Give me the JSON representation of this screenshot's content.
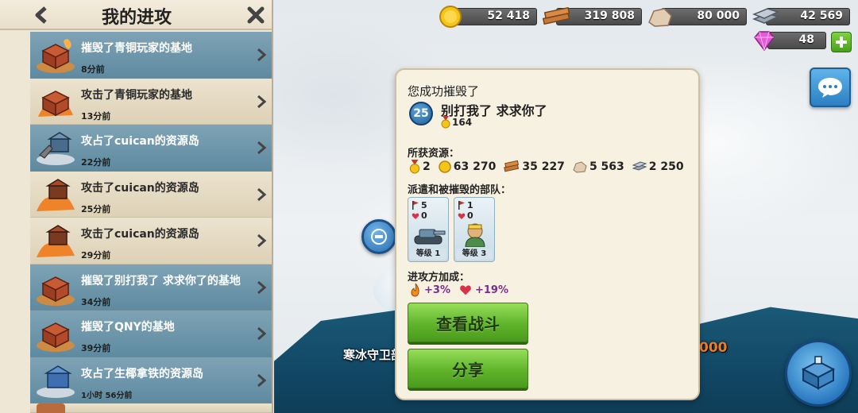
{
  "sidebar": {
    "title": "我的进攻",
    "items": [
      {
        "title": "摧毁了青铜玩家的基地",
        "time": "8分前",
        "style": "blue",
        "icon": "burning-hq-icon"
      },
      {
        "title": "攻击了青铜玩家的基地",
        "time": "13分前",
        "style": "beige",
        "icon": "burning-hq-icon"
      },
      {
        "title": "攻占了cuican的资源岛",
        "time": "22分前",
        "style": "blue",
        "icon": "resource-island-icon"
      },
      {
        "title": "攻击了cuican的资源岛",
        "time": "25分前",
        "style": "beige",
        "icon": "burning-island-icon"
      },
      {
        "title": "攻击了cuican的资源岛",
        "time": "29分前",
        "style": "beige",
        "icon": "burning-island-icon"
      },
      {
        "title": "摧毁了别打我了 求求你了的基地",
        "time": "34分前",
        "style": "blue",
        "icon": "burning-hq-icon"
      },
      {
        "title": "摧毁了QNY的基地",
        "time": "39分前",
        "style": "blue",
        "icon": "burning-hq-icon"
      },
      {
        "title": "攻占了生椰拿铁的资源岛",
        "time": "1小时 56分前",
        "style": "blue",
        "icon": "resource-island-icon"
      }
    ]
  },
  "resources": {
    "gold": "52 418",
    "wood": "319 808",
    "stone": "80 000",
    "iron": "42 569",
    "diamonds": "48"
  },
  "map": {
    "island_label": "寒冰守卫部",
    "number_text": "000"
  },
  "card": {
    "heading": "您成功摧毁了",
    "enemy_level": "25",
    "enemy_name": "别打我了 求求你了",
    "enemy_medals": "164",
    "loot_label": "所获资源：",
    "loot": {
      "medals": "2",
      "gold": "63 270",
      "wood": "35 227",
      "stone": "5 563",
      "iron": "2 250"
    },
    "troops_label": "派遣和被摧毁的部队：",
    "troops": [
      {
        "sent": "5",
        "lost": "0",
        "level": "等级 1",
        "kind": "tank"
      },
      {
        "sent": "1",
        "lost": "0",
        "level": "等级 3",
        "kind": "heavy"
      }
    ],
    "bonus_label": "进攻方加成：",
    "bonus_fire": "+3%",
    "bonus_heart": "+19%",
    "view_battle_label": "查看战斗",
    "share_label": "分享"
  },
  "colors": {
    "accent_green": "#5fb42a",
    "row_blue": "#5e8aa0",
    "row_beige": "#ddd1b6",
    "bonus_purple": "#7a2d8c"
  }
}
